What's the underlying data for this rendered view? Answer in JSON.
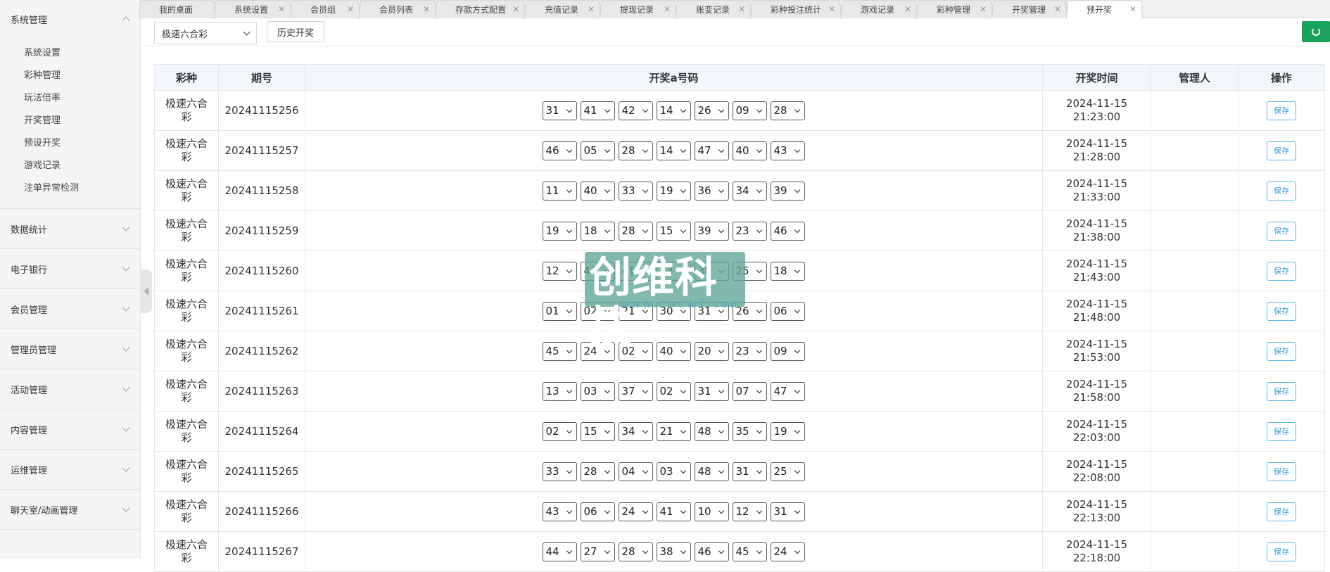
{
  "sidebar": {
    "groups": [
      {
        "label": "系统管理",
        "open": true,
        "items": [
          "系统设置",
          "彩种管理",
          "玩法倍率",
          "开奖管理",
          "预设开奖",
          "游戏记录",
          "注单异常检测"
        ]
      },
      {
        "label": "数据统计"
      },
      {
        "label": "电子银行"
      },
      {
        "label": "会员管理"
      },
      {
        "label": "管理员管理"
      },
      {
        "label": "活动管理"
      },
      {
        "label": "内容管理"
      },
      {
        "label": "运维管理"
      },
      {
        "label": "聊天室/动画管理"
      }
    ]
  },
  "tabs": [
    {
      "label": "我的桌面",
      "closable": false
    },
    {
      "label": "系统设置",
      "closable": true
    },
    {
      "label": "会员组",
      "closable": true
    },
    {
      "label": "会员列表",
      "closable": true
    },
    {
      "label": "存款方式配置",
      "closable": true
    },
    {
      "label": "充值记录",
      "closable": true
    },
    {
      "label": "提现记录",
      "closable": true
    },
    {
      "label": "账变记录",
      "closable": true
    },
    {
      "label": "彩种投注统计",
      "closable": true
    },
    {
      "label": "游戏记录",
      "closable": true
    },
    {
      "label": "彩种管理",
      "closable": true
    },
    {
      "label": "开奖管理",
      "closable": true
    },
    {
      "label": "预开奖",
      "closable": true,
      "active": true
    }
  ],
  "toolbar": {
    "lottery_select": "极速六合彩",
    "history_button": "历史开奖",
    "refresh_icon": "refresh-icon",
    "refresh_color": "#1aa35a"
  },
  "table": {
    "headers": [
      "彩种",
      "期号",
      "开奖a号码",
      "开奖时间",
      "管理人",
      "操作"
    ],
    "save_label": "保存",
    "rows": [
      {
        "kind": "极速六合彩",
        "issue": "20241115256",
        "nums": [
          "31",
          "41",
          "42",
          "14",
          "26",
          "09",
          "28"
        ],
        "time": "2024-11-15 21:23:00",
        "manager": ""
      },
      {
        "kind": "极速六合彩",
        "issue": "20241115257",
        "nums": [
          "46",
          "05",
          "28",
          "14",
          "47",
          "40",
          "43"
        ],
        "time": "2024-11-15 21:28:00",
        "manager": ""
      },
      {
        "kind": "极速六合彩",
        "issue": "20241115258",
        "nums": [
          "11",
          "40",
          "33",
          "19",
          "36",
          "34",
          "39"
        ],
        "time": "2024-11-15 21:33:00",
        "manager": ""
      },
      {
        "kind": "极速六合彩",
        "issue": "20241115259",
        "nums": [
          "19",
          "18",
          "28",
          "15",
          "39",
          "23",
          "46"
        ],
        "time": "2024-11-15 21:38:00",
        "manager": ""
      },
      {
        "kind": "极速六合彩",
        "issue": "20241115260",
        "nums": [
          "12",
          "43",
          "41",
          "13",
          "38",
          "25",
          "18"
        ],
        "time": "2024-11-15 21:43:00",
        "manager": ""
      },
      {
        "kind": "极速六合彩",
        "issue": "20241115261",
        "nums": [
          "01",
          "02",
          "21",
          "30",
          "31",
          "26",
          "06"
        ],
        "time": "2024-11-15 21:48:00",
        "manager": ""
      },
      {
        "kind": "极速六合彩",
        "issue": "20241115262",
        "nums": [
          "45",
          "24",
          "02",
          "40",
          "20",
          "23",
          "09"
        ],
        "time": "2024-11-15 21:53:00",
        "manager": ""
      },
      {
        "kind": "极速六合彩",
        "issue": "20241115263",
        "nums": [
          "13",
          "03",
          "37",
          "02",
          "31",
          "07",
          "47"
        ],
        "time": "2024-11-15 21:58:00",
        "manager": ""
      },
      {
        "kind": "极速六合彩",
        "issue": "20241115264",
        "nums": [
          "02",
          "15",
          "34",
          "21",
          "48",
          "35",
          "19"
        ],
        "time": "2024-11-15 22:03:00",
        "manager": ""
      },
      {
        "kind": "极速六合彩",
        "issue": "20241115265",
        "nums": [
          "33",
          "28",
          "04",
          "03",
          "48",
          "31",
          "25"
        ],
        "time": "2024-11-15 22:08:00",
        "manager": ""
      },
      {
        "kind": "极速六合彩",
        "issue": "20241115266",
        "nums": [
          "43",
          "06",
          "24",
          "41",
          "10",
          "12",
          "31"
        ],
        "time": "2024-11-15 22:13:00",
        "manager": ""
      },
      {
        "kind": "极速六合彩",
        "issue": "20241115267",
        "nums": [
          "44",
          "27",
          "28",
          "38",
          "46",
          "45",
          "24"
        ],
        "time": "2024-11-15 22:18:00",
        "manager": ""
      }
    ]
  },
  "watermark": {
    "text": "创维科技",
    "url": "www.cwcw7.com"
  }
}
